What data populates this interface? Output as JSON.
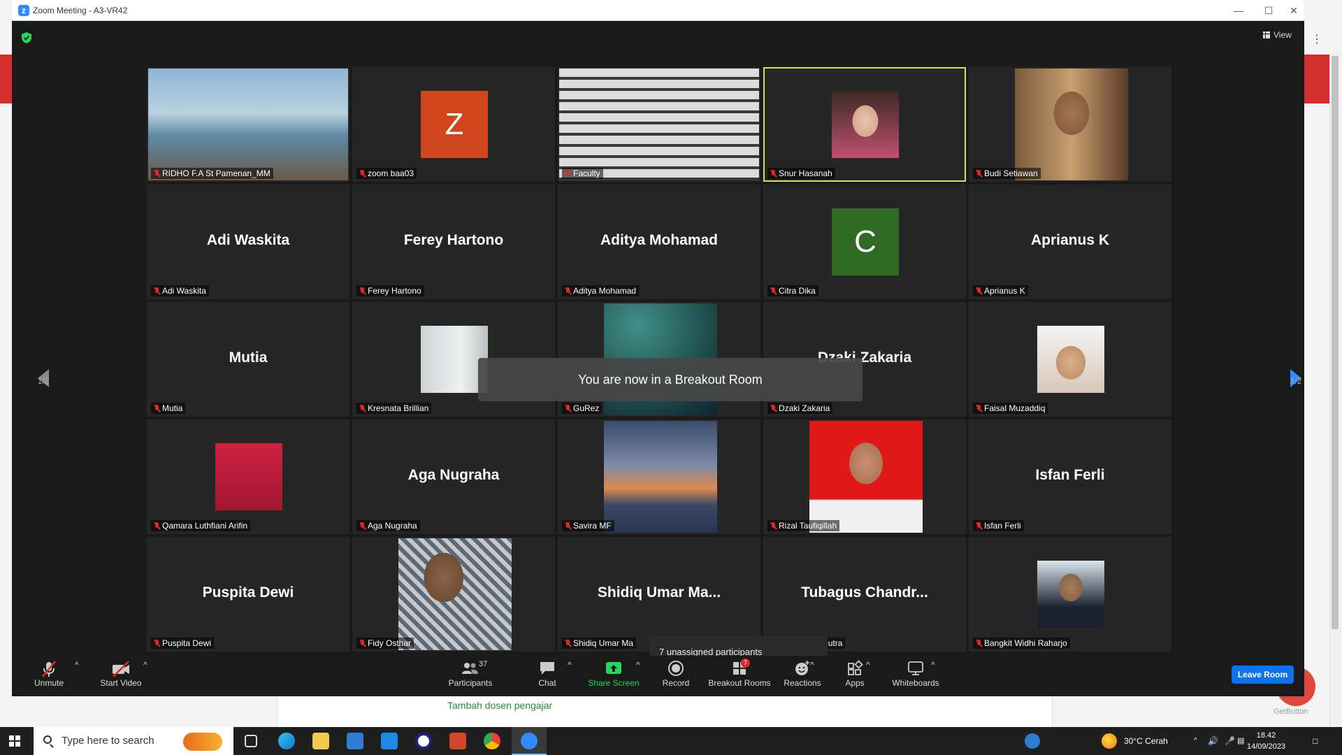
{
  "window": {
    "title": "Zoom Meeting - A3-VR42",
    "view_label": "View"
  },
  "tiles": [
    {
      "name": "RIDHO F.A St Pamenan_MM",
      "kind": "video",
      "photo": "ph-sea"
    },
    {
      "name": "zoom baa03",
      "kind": "letter",
      "letter": "Z",
      "color": "#d2461d"
    },
    {
      "name": "Faculty",
      "kind": "video",
      "photo": "ph-room"
    },
    {
      "name": "Snur Hasanah",
      "kind": "photo",
      "photo": "ph-girl",
      "active": true
    },
    {
      "name": "Budi Setiawan",
      "kind": "photo",
      "photo": "ph-man-shop"
    },
    {
      "name": "Adi Waskita",
      "kind": "text",
      "display": "Adi Waskita"
    },
    {
      "name": "Ferey Hartono",
      "kind": "text",
      "display": "Ferey Hartono"
    },
    {
      "name": "Aditya Mohamad",
      "kind": "text",
      "display": "Aditya Mohamad"
    },
    {
      "name": "Citra Dika",
      "kind": "letter",
      "letter": "C",
      "color": "#2f6b22"
    },
    {
      "name": "Aprianus K",
      "kind": "text",
      "display": "Aprianus K"
    },
    {
      "name": "Mutia",
      "kind": "text",
      "display": "Mutia"
    },
    {
      "name": "Kresnata Brillian",
      "kind": "photo",
      "photo": "ph-mirror"
    },
    {
      "name": "GuRez",
      "kind": "photo",
      "photo": "ph-surgery"
    },
    {
      "name": "Dzaki Zakaria",
      "kind": "text",
      "display": "Dzaki Zakaria"
    },
    {
      "name": "Faisal Muzaddiq",
      "kind": "photo",
      "photo": "ph-chef"
    },
    {
      "name": "Qamara Luthfiani Arifin",
      "kind": "photo",
      "photo": "ph-red"
    },
    {
      "name": "Aga Nugraha",
      "kind": "text",
      "display": "Aga Nugraha"
    },
    {
      "name": "Savira MF",
      "kind": "photo",
      "photo": "ph-sunset"
    },
    {
      "name": "Rizal Taufiqillah",
      "kind": "photo",
      "photo": "ph-redid"
    },
    {
      "name": "Isfan Ferli",
      "kind": "text",
      "display": "Isfan Ferli"
    },
    {
      "name": "Puspita Dewi",
      "kind": "text",
      "display": "Puspita Dewi"
    },
    {
      "name": "Fidy Osthar",
      "kind": "photo",
      "photo": "ph-fidy"
    },
    {
      "name": "Shidiq Umar Ma",
      "kind": "text",
      "display": "Shidiq Umar Ma..."
    },
    {
      "name": "Chandra Saputra",
      "kind": "text",
      "display": "Tubagus Chandr..."
    },
    {
      "name": "Bangkit Widhi Raharjo",
      "kind": "photo",
      "photo": "ph-suit"
    }
  ],
  "overlay": {
    "breakout_toast": "You are now in a Breakout Room",
    "unassigned": "7 unassigned participants",
    "pager_left": "1/2",
    "pager_right": "1/2"
  },
  "toolbar": {
    "unmute": "Unmute",
    "start_video": "Start Video",
    "participants": "Participants",
    "participants_count": "37",
    "chat": "Chat",
    "share_screen": "Share Screen",
    "record": "Record",
    "breakout_rooms": "Breakout Rooms",
    "breakout_badge": "7",
    "reactions": "Reactions",
    "apps": "Apps",
    "whiteboards": "Whiteboards",
    "leave_room": "Leave Room"
  },
  "background_page": {
    "link": "Tambah dosen pengajar",
    "getbutton": "GetButton"
  },
  "taskbar": {
    "search_placeholder": "Type here to search",
    "weather": "30°C  Cerah",
    "time": "18.42",
    "date": "14/09/2023"
  },
  "colors": {
    "accent_blue": "#0e72ed",
    "active_border": "#d4e25b",
    "share_green": "#23d959",
    "muted_red": "#e02828"
  }
}
